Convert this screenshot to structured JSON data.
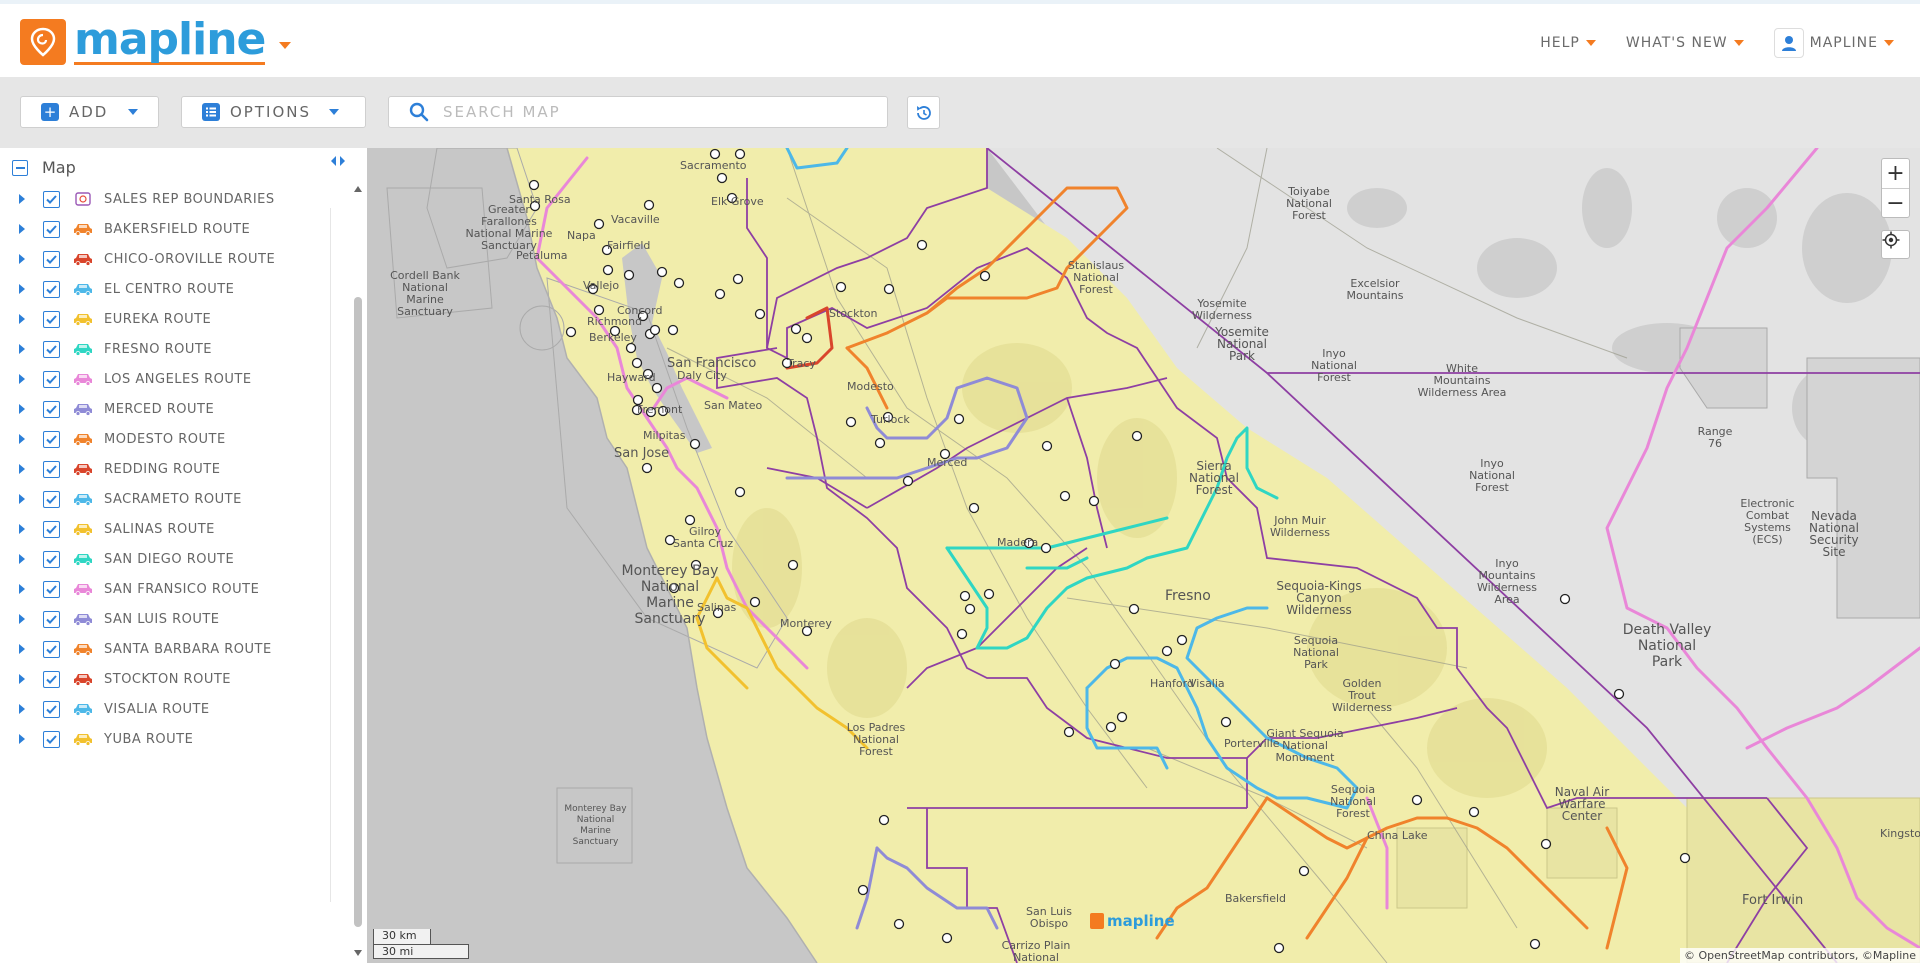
{
  "app": {
    "logo_text": "mapline",
    "colors": {
      "brand_blue": "#2d9cdb",
      "brand_orange": "#f47b20",
      "accent": "#2d7fd8"
    }
  },
  "topnav": {
    "help": "HELP",
    "whats_new": "WHAT'S NEW",
    "user": "MAPLINE"
  },
  "toolbar": {
    "add_label": "ADD",
    "options_label": "OPTIONS",
    "search_placeholder": "SEARCH MAP",
    "refresh_icon": "refresh-icon"
  },
  "sidebar": {
    "root_label": "Map",
    "layers": [
      {
        "label": "SALES REP BOUNDARIES",
        "icon": "territory-icon",
        "color": "#9b59b6",
        "checked": true
      },
      {
        "label": "BAKERSFIELD ROUTE",
        "icon": "car-icon",
        "color": "#f0832c",
        "checked": true
      },
      {
        "label": "CHICO-OROVILLE ROUTE",
        "icon": "car-icon",
        "color": "#d9452b",
        "checked": true
      },
      {
        "label": "EL CENTRO ROUTE",
        "icon": "car-icon",
        "color": "#4db8e8",
        "checked": true
      },
      {
        "label": "EUREKA ROUTE",
        "icon": "car-icon",
        "color": "#f2c12e",
        "checked": true
      },
      {
        "label": "FRESNO ROUTE",
        "icon": "car-icon",
        "color": "#2fd6c3",
        "checked": true
      },
      {
        "label": "LOS ANGELES ROUTE",
        "icon": "car-icon",
        "color": "#e987d8",
        "checked": true
      },
      {
        "label": "MERCED ROUTE",
        "icon": "car-icon",
        "color": "#8f8bd6",
        "checked": true
      },
      {
        "label": "MODESTO ROUTE",
        "icon": "car-icon",
        "color": "#f0832c",
        "checked": true
      },
      {
        "label": "REDDING ROUTE",
        "icon": "car-icon",
        "color": "#d9452b",
        "checked": true
      },
      {
        "label": "SACRAMETO ROUTE",
        "icon": "car-icon",
        "color": "#4db8e8",
        "checked": true
      },
      {
        "label": "SALINAS ROUTE",
        "icon": "car-icon",
        "color": "#f2c12e",
        "checked": true
      },
      {
        "label": "SAN DIEGO ROUTE",
        "icon": "car-icon",
        "color": "#2fd6c3",
        "checked": true
      },
      {
        "label": "SAN FRANSICO ROUTE",
        "icon": "car-icon",
        "color": "#e987d8",
        "checked": true
      },
      {
        "label": "SAN LUIS ROUTE",
        "icon": "car-icon",
        "color": "#8f8bd6",
        "checked": true
      },
      {
        "label": "SANTA BARBARA ROUTE",
        "icon": "car-icon",
        "color": "#f0832c",
        "checked": true
      },
      {
        "label": "STOCKTON ROUTE",
        "icon": "car-icon",
        "color": "#d9452b",
        "checked": true
      },
      {
        "label": "VISALIA ROUTE",
        "icon": "car-icon",
        "color": "#4db8e8",
        "checked": true
      },
      {
        "label": "YUBA ROUTE",
        "icon": "car-icon",
        "color": "#f2c12e",
        "checked": true
      }
    ]
  },
  "map": {
    "places": {
      "sacramento": "Sacramento",
      "elk_grove": "Elk Grove",
      "santa_rosa": "Santa Rosa",
      "vacaville": "Vacaville",
      "napa": "Napa",
      "fairfield": "Fairfield",
      "petaluma": "Petaluma",
      "vallejo": "Vallejo",
      "concord": "Concord",
      "richmond": "Richmond",
      "berkeley": "Berkeley",
      "san_francisco": "San Francisco",
      "daly_city": "Daly City",
      "hayward": "Hayward",
      "san_mateo": "San Mateo",
      "fremont": "Fremont",
      "milpitas": "Milpitas",
      "san_jose": "San Jose",
      "gilroy": "Gilroy",
      "santa_cruz": "Santa Cruz",
      "salinas": "Salinas",
      "monterey": "Monterey",
      "stockton": "Stockton",
      "tracy": "Tracy",
      "modesto": "Modesto",
      "turlock": "Turlock",
      "merced": "Merced",
      "madera": "Madera",
      "fresno": "Fresno",
      "hanford": "Hanford",
      "visalia": "Visalia",
      "porterville": "Porterville",
      "bakersfield": "Bakersfield",
      "san_luis_obispo": "San Luis Obispo",
      "china_lake": "China Lake",
      "fort_irwin": "Fort Irwin",
      "greater_farallones": "Greater Farallones National Marine Sanctuary",
      "cordell_bank": "Cordell Bank National Marine Sanctuary",
      "monterey_bay": "Monterey Bay National Marine Sanctuary",
      "monterey_bay_small": "Monterey Bay National Marine Sanctuary",
      "stanislaus": "Stanislaus National Forest",
      "yosemite_wild": "Yosemite Wilderness",
      "yosemite_np": "Yosemite National Park",
      "sierra_nf": "Sierra National Forest",
      "john_muir": "John Muir Wilderness",
      "sequoia_kings": "Sequoia-Kings Canyon Wilderness",
      "sequoia_np": "Sequoia National Park",
      "golden_trout": "Golden Trout Wilderness",
      "giant_sequoia": "Giant Sequoia National Monument",
      "sequoia_nf": "Sequoia National Forest",
      "los_padres": "Los Padres National Forest",
      "toiyabe": "Toiyabe National Forest",
      "excelsior": "Excelsior Mountains",
      "inyo_nf_n": "Inyo National Forest",
      "white_mountains": "White Mountains Wilderness Area",
      "inyo_nf": "Inyo National Forest",
      "inyo_mtn": "Inyo Mountains Wilderness Area",
      "range_76": "Range 76",
      "ecs": "Electronic Combat Systems (ECS)",
      "nevada_nss": "Nevada National Security Site",
      "death_valley": "Death Valley National Park",
      "naval_air": "Naval Air Warfare Center",
      "kingston": "Kingsto",
      "carrizo": "Carrizo Plain National"
    },
    "scale_km": "30 km",
    "scale_mi": "30 mi",
    "attribution": "© OpenStreetMap contributors, ©Mapline",
    "watermark": "mapline",
    "zoom_in": "+",
    "zoom_out": "−"
  }
}
